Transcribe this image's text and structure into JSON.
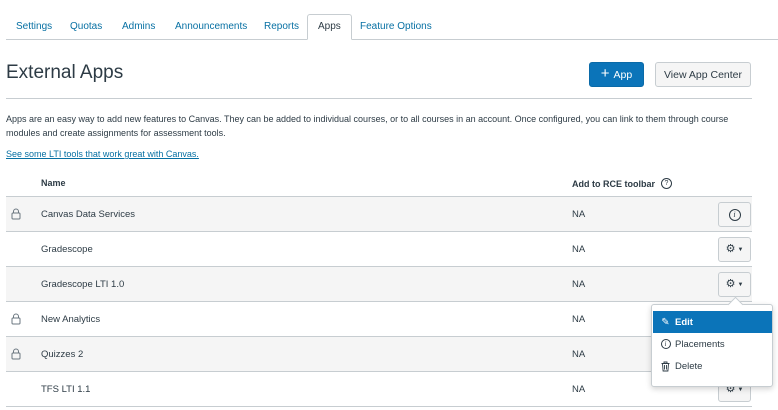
{
  "tabs": [
    {
      "label": "Settings"
    },
    {
      "label": "Quotas"
    },
    {
      "label": "Admins"
    },
    {
      "label": "Announcements"
    },
    {
      "label": "Reports"
    },
    {
      "label": "Apps",
      "active": true
    },
    {
      "label": "Feature Options"
    }
  ],
  "header": {
    "title": "External Apps",
    "add_app_label": "App",
    "view_app_center_label": "View App Center"
  },
  "description": "Apps are an easy way to add new features to Canvas. They can be added to individual courses, or to all courses in an account. Once configured, you can link to them through course modules and create assignments for assessment tools.",
  "lti_link": "See some LTI tools that work great with Canvas.",
  "table": {
    "columns": {
      "name": "Name",
      "rce": "Add to RCE toolbar"
    },
    "rows": [
      {
        "name": "Canvas Data Services",
        "rce": "NA",
        "locked": true,
        "action": "info-icon"
      },
      {
        "name": "Gradescope",
        "rce": "NA",
        "locked": false,
        "action": "gear-icon"
      },
      {
        "name": "Gradescope LTI 1.0",
        "rce": "NA",
        "locked": false,
        "action": "gear-icon"
      },
      {
        "name": "New Analytics",
        "rce": "NA",
        "locked": true,
        "action": "none"
      },
      {
        "name": "Quizzes 2",
        "rce": "NA",
        "locked": true,
        "action": "none"
      },
      {
        "name": "TFS LTI 1.1",
        "rce": "NA",
        "locked": false,
        "action": "gear-icon"
      }
    ]
  },
  "menu": {
    "items": [
      {
        "label": "Edit",
        "icon": "pencil-icon",
        "active": true
      },
      {
        "label": "Placements",
        "icon": "info-icon"
      },
      {
        "label": "Delete",
        "icon": "trash-icon"
      }
    ]
  },
  "colors": {
    "accent": "#0b74b9",
    "link": "#0770a3",
    "text": "#2d3b45",
    "border": "#c7cdd1"
  }
}
